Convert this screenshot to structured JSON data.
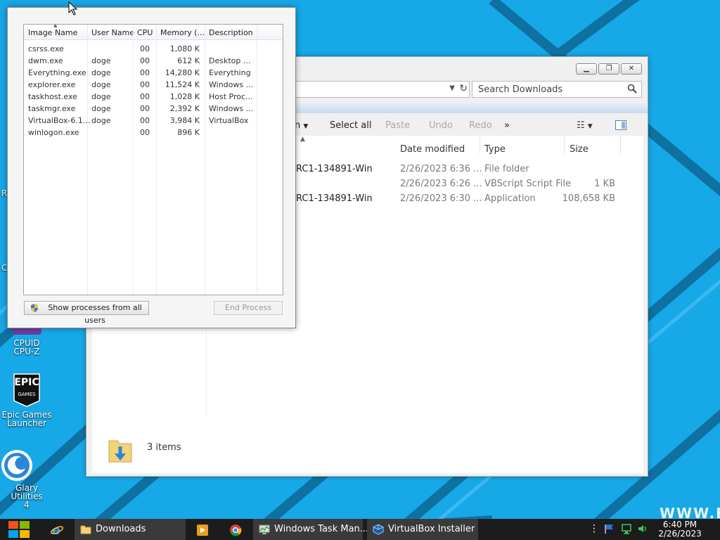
{
  "desktop": {
    "icons": [
      {
        "name": "CPUID CPU-Z",
        "line1": "CPUID",
        "line2": "CPU-Z"
      },
      {
        "name": "Epic Games Launcher",
        "line1": "Epic Games",
        "line2": "Launcher",
        "logo_line1": "EPIC",
        "logo_line2": "GAMES"
      },
      {
        "name": "Glary Utilities 4",
        "line1": "Glary Utilities",
        "line2": "4"
      }
    ],
    "edge_fragments": [
      "R",
      "C"
    ],
    "watermark": "WWW.E"
  },
  "explorer": {
    "search_placeholder": "Search Downloads",
    "toolbar": {
      "cut_fragment": "n",
      "select_all": "Select all",
      "paste": "Paste",
      "undo": "Undo",
      "redo": "Redo",
      "more": "»"
    },
    "columns": {
      "date_modified": "Date modified",
      "type": "Type",
      "size": "Size"
    },
    "rows": [
      {
        "name": "RC1-134891-Win",
        "date": "2/26/2023 6:36 ...",
        "type": "File folder",
        "size": ""
      },
      {
        "name": "",
        "date": "2/26/2023 6:26 ...",
        "type": "VBScript Script File",
        "size": "1 KB"
      },
      {
        "name": "RC1-134891-Win",
        "date": "2/26/2023 6:30 ...",
        "type": "Application",
        "size": "108,658 KB"
      }
    ],
    "status": "3 items"
  },
  "taskmgr": {
    "columns": {
      "image_name": "Image Name",
      "user_name": "User Name",
      "cpu": "CPU",
      "memory": "Memory (...",
      "description": "Description"
    },
    "processes": [
      {
        "image": "csrss.exe",
        "user": "",
        "cpu": "00",
        "memory": "1,080 K",
        "desc": ""
      },
      {
        "image": "dwm.exe",
        "user": "doge",
        "cpu": "00",
        "memory": "612 K",
        "desc": "Desktop ..."
      },
      {
        "image": "Everything.exe",
        "user": "doge",
        "cpu": "00",
        "memory": "14,280 K",
        "desc": "Everything"
      },
      {
        "image": "explorer.exe",
        "user": "doge",
        "cpu": "00",
        "memory": "11,524 K",
        "desc": "Windows ..."
      },
      {
        "image": "taskhost.exe",
        "user": "doge",
        "cpu": "00",
        "memory": "1,028 K",
        "desc": "Host Proc..."
      },
      {
        "image": "taskmgr.exe",
        "user": "doge",
        "cpu": "00",
        "memory": "2,392 K",
        "desc": "Windows ..."
      },
      {
        "image": "VirtualBox-6.1...",
        "user": "doge",
        "cpu": "00",
        "memory": "3,984 K",
        "desc": "VirtualBox"
      },
      {
        "image": "winlogon.exe",
        "user": "",
        "cpu": "00",
        "memory": "896 K",
        "desc": ""
      }
    ],
    "show_all_button": "Show processes from all users",
    "end_process_button": "End Process"
  },
  "taskbar": {
    "tasks": [
      {
        "label": "Downloads",
        "icon": "folder-icon"
      },
      {
        "label": "Windows Task Man...",
        "icon": "taskmgr-icon"
      },
      {
        "label": "VirtualBox Installer",
        "icon": "virtualbox-icon"
      }
    ],
    "clock_time": "6:40 PM",
    "clock_date": "2/26/2023"
  }
}
